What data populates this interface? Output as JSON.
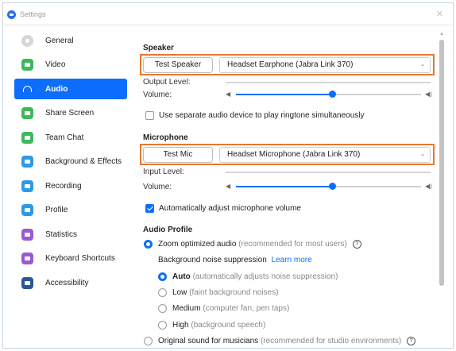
{
  "window": {
    "title": "Settings"
  },
  "sidebar": {
    "items": [
      {
        "label": "General",
        "icon": "gear-icon",
        "color": "#d7d7d7",
        "active": false
      },
      {
        "label": "Video",
        "icon": "video-icon",
        "color": "#3db85d",
        "active": false
      },
      {
        "label": "Audio",
        "icon": "headphone-icon",
        "color": "#0d6efd",
        "active": true
      },
      {
        "label": "Share Screen",
        "icon": "share-screen-icon",
        "color": "#3db85d",
        "active": false
      },
      {
        "label": "Team Chat",
        "icon": "chat-icon",
        "color": "#3db85d",
        "active": false
      },
      {
        "label": "Background & Effects",
        "icon": "background-icon",
        "color": "#2c9be6",
        "active": false
      },
      {
        "label": "Recording",
        "icon": "recording-icon",
        "color": "#2c9be6",
        "active": false
      },
      {
        "label": "Profile",
        "icon": "profile-icon",
        "color": "#2c9be6",
        "active": false
      },
      {
        "label": "Statistics",
        "icon": "statistics-icon",
        "color": "#9b59d0",
        "active": false
      },
      {
        "label": "Keyboard Shortcuts",
        "icon": "keyboard-icon",
        "color": "#9b59d0",
        "active": false
      },
      {
        "label": "Accessibility",
        "icon": "accessibility-icon",
        "color": "#2b5797",
        "active": false
      }
    ]
  },
  "speaker": {
    "title": "Speaker",
    "test_button": "Test Speaker",
    "device": "Headset Earphone (Jabra Link 370)",
    "output_level_label": "Output Level:",
    "volume_label": "Volume:",
    "volume_level": 0.52
  },
  "separate_device": {
    "label": "Use separate audio device to play ringtone simultaneously",
    "checked": false
  },
  "microphone": {
    "title": "Microphone",
    "test_button": "Test Mic",
    "device": "Headset Microphone (Jabra Link 370)",
    "input_level_label": "Input Level:",
    "volume_label": "Volume:",
    "volume_level": 0.52
  },
  "auto_adjust": {
    "label": "Automatically adjust microphone volume",
    "checked": true
  },
  "audio_profile": {
    "title": "Audio Profile",
    "zoom_optimized": {
      "label": "Zoom optimized audio",
      "desc": "(recommended for most users)",
      "selected": true
    },
    "noise_label": "Background noise suppression",
    "learn_more": "Learn more",
    "noise_options": [
      {
        "label": "Auto",
        "desc": "(automatically adjusts noise suppression)",
        "selected": true
      },
      {
        "label": "Low",
        "desc": "(faint background noises)",
        "selected": false
      },
      {
        "label": "Medium",
        "desc": "(computer fan, pen taps)",
        "selected": false
      },
      {
        "label": "High",
        "desc": "(background speech)",
        "selected": false
      }
    ],
    "original_sound": {
      "label": "Original sound for musicians",
      "desc": "(recommended for studio environments)",
      "selected": false
    }
  },
  "colors": {
    "accent": "#0d6efd",
    "highlight_border": "#e8782a"
  }
}
